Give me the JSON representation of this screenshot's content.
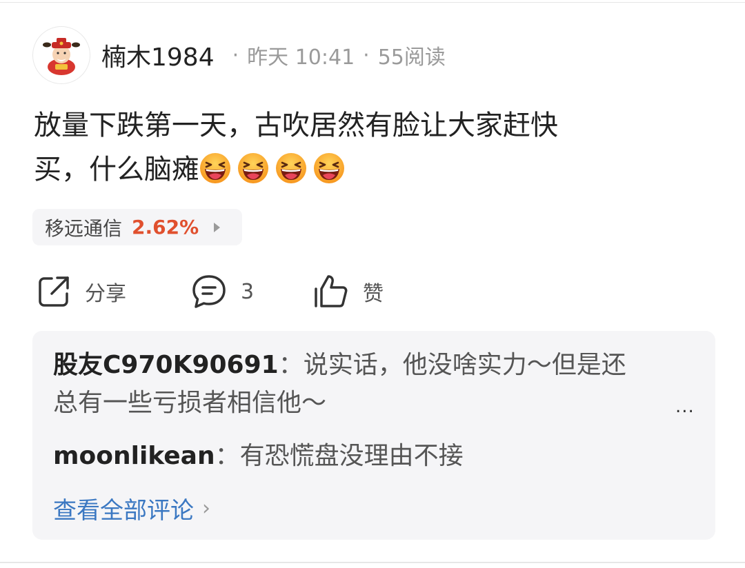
{
  "post": {
    "author": "楠木1984",
    "time": "昨天 10:41",
    "reads": "55阅读",
    "separator": "·",
    "text_line1": "放量下跌第一天，古吹居然有脸让大家赶快",
    "text_line2": "买，什么脑瘫",
    "emoji_count": 4,
    "emoji_icon": "grinning-squinting-face"
  },
  "stock": {
    "name": "移远通信",
    "change": "2.62%",
    "change_color": "#e0502e"
  },
  "actions": {
    "share_label": "分享",
    "comment_count": "3",
    "like_label": "赞"
  },
  "comments": {
    "items": [
      {
        "user": "股友C970K90691",
        "colon": "：",
        "text_line1": "说实话，他没啥实力～但是还",
        "text_line2": "总有一些亏损者相信他～"
      },
      {
        "user": "moonlikean",
        "colon": "：",
        "text": "有恐慌盘没理由不接"
      }
    ],
    "more_label": "...",
    "view_all_label": "查看全部评论",
    "link_color": "#3b78c2"
  }
}
